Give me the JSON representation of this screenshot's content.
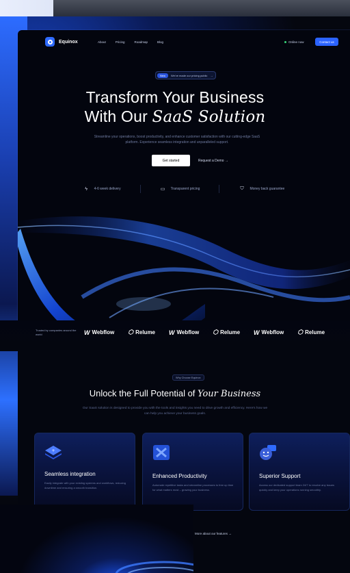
{
  "nav": {
    "brand": "Equinox",
    "links": [
      "About",
      "Pricing",
      "Roadmap",
      "Blog"
    ],
    "status": "Online now",
    "contact": "Contact us"
  },
  "announcement": {
    "badge": "New",
    "text": "We've made our pricing public",
    "arrow": "→"
  },
  "hero": {
    "title_line1": "Transform Your Business",
    "title_line2_prefix": "With Our ",
    "title_line2_italic": "SaaS Solution",
    "subtitle": "Streamline your operations, boost productivity, and enhance customer satisfaction with our cutting-edge SaaS platform. Experience seamless integration and unparalleled support.",
    "primary_cta": "Get started",
    "secondary_cta": "Request a Demo →"
  },
  "features": [
    {
      "icon": "bolt-icon",
      "label": "4-6 week delivery"
    },
    {
      "icon": "card-icon",
      "label": "Transparent pricing"
    },
    {
      "icon": "shield-check-icon",
      "label": "Money back guarantee"
    }
  ],
  "trusted": {
    "label": "Trusted by companies around the world",
    "brands": [
      "Webflow",
      "Relume",
      "Webflow",
      "Relume",
      "Webflow",
      "Relume"
    ]
  },
  "why": {
    "tag": "Why Choose Equinox",
    "title_prefix": "Unlock the Full Potential of ",
    "title_italic": "Your Business",
    "subtitle": "Our SaaS solution is designed to provide you with the tools and insights you need to drive growth and efficiency. Here's how we can help you achieve your business goals."
  },
  "cards": [
    {
      "title": "Seamless integration",
      "desc": "Easily integrate with your existing systems and workflows, reducing downtime and ensuring a smooth transition.",
      "icon": "layers-icon"
    },
    {
      "title": "Enhanced Productivity",
      "desc": "Automate repetitive tasks and streamline processes to free up time for what matters most – growing your business.",
      "icon": "puzzle-icon"
    },
    {
      "title": "Superior Support",
      "desc": "Access our dedicated support team 24/7 to resolve any issues quickly and keep your operations running smoothly.",
      "icon": "chat-icon"
    }
  ],
  "more_link": "More about our features →",
  "colors": {
    "accent": "#2b63ff",
    "bg": "#03050e"
  }
}
